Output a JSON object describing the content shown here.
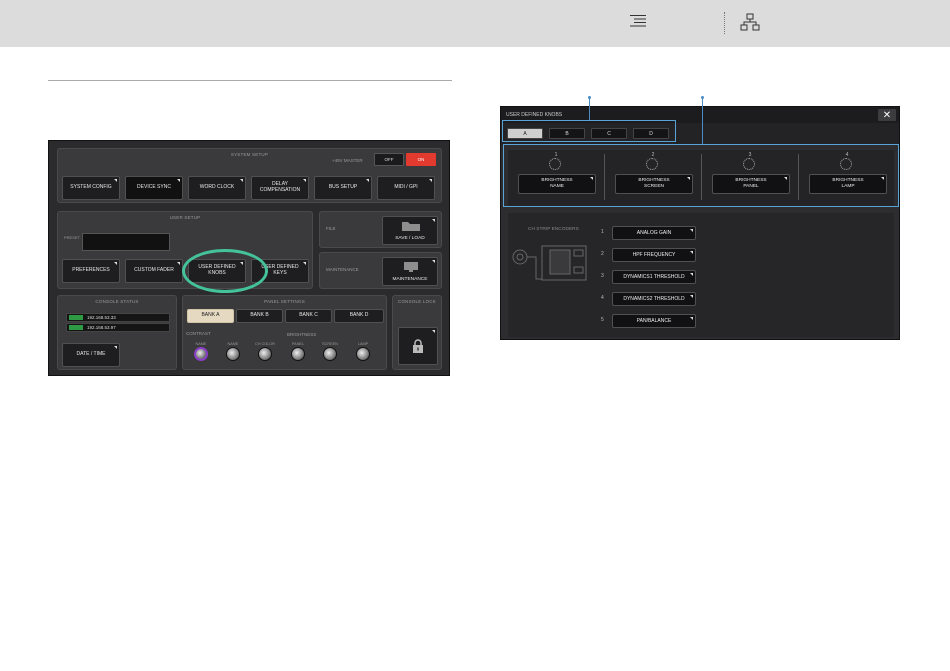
{
  "header": {
    "icons": [
      "list-icon",
      "sitemap-icon"
    ]
  },
  "left_panel": {
    "system_setup": {
      "title": "SYSTEM SETUP",
      "phantom_label": "+48V MASTER",
      "phantom_off": "OFF",
      "phantom_on": "ON",
      "buttons": [
        "SYSTEM CONFIG",
        "DEVICE SYNC",
        "WORD CLOCK",
        "DELAY\nCOMPENSATION",
        "BUS SETUP",
        "MIDI / GPI"
      ]
    },
    "user_setup": {
      "title": "USER SETUP",
      "preset_label": "PRESET",
      "buttons": [
        "PREFERENCES",
        "CUSTOM FADER",
        "USER DEFINED\nKNOBS",
        "USER DEFINED\nKEYS"
      ]
    },
    "file": {
      "label": "FILE",
      "button": "SAVE / LOAD"
    },
    "maintenance": {
      "label": "MAINTENANCE",
      "button": "MAINTENANCE"
    },
    "console_status": {
      "title": "CONSOLE STATUS",
      "ips": [
        {
          "tag": "CONSOLE",
          "value": "192.168.53.33"
        },
        {
          "tag": "DISPLAY",
          "value": "192.168.53.97"
        }
      ],
      "date_button": "DATE / TIME"
    },
    "panel_settings": {
      "title": "PANEL SETTINGS",
      "banks": [
        "BANK A",
        "BANK B",
        "BANK C",
        "BANK D"
      ],
      "contrast_label": "CONTRAST",
      "brightness_label": "BRIGHTNESS",
      "knobs": [
        "NAME",
        "NAME",
        "CH COLOR",
        "PANEL",
        "SCREEN",
        "LAMP"
      ]
    },
    "console_lock": {
      "title": "CONSOLE LOCK"
    }
  },
  "right_panel": {
    "title": "USER DEFINED KNOBS",
    "close": "✕",
    "tabs": [
      "A",
      "B",
      "C",
      "D"
    ],
    "knobs": [
      {
        "num": "1",
        "label": "BRIGHTNESS\nNAME"
      },
      {
        "num": "2",
        "label": "BRIGHTNESS\nSCREEN"
      },
      {
        "num": "3",
        "label": "BRIGHTNESS\nPANEL"
      },
      {
        "num": "4",
        "label": "BRIGHTNESS\nLAMP"
      }
    ],
    "encoders_title": "CH STRIP ENCODERS",
    "encoders": [
      {
        "num": "1",
        "label": "ANALOG GAIN"
      },
      {
        "num": "2",
        "label": "HPF FREQUENCY"
      },
      {
        "num": "3",
        "label": "DYNAMICS1 THRESHOLD"
      },
      {
        "num": "4",
        "label": "DYNAMICS2 THRESHOLD"
      },
      {
        "num": "5",
        "label": "PAN/BALANCE"
      }
    ]
  }
}
